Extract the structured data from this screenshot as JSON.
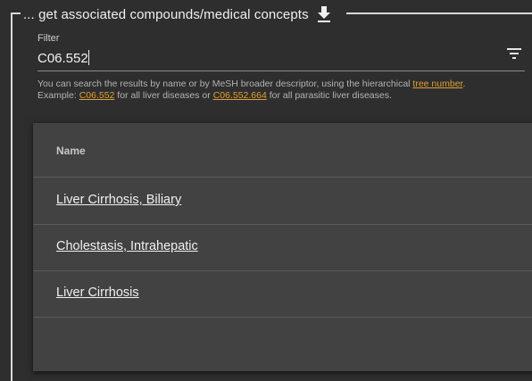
{
  "section": {
    "legend": "... get associated compounds/medical concepts"
  },
  "filter": {
    "label": "Filter",
    "value": "C06.552",
    "hint_prefix": "You can search the results by name or by MeSH broader descriptor, using the hierarchical ",
    "hint_link_tree": "tree number",
    "hint_after_tree": ".",
    "hint_example_prefix": "Example: ",
    "hint_link_example1": "C06.552",
    "hint_mid": " for all liver diseases or ",
    "hint_link_example2": "C06.552.664",
    "hint_suffix": " for all parasitic liver diseases."
  },
  "table": {
    "column_header": "Name",
    "rows": [
      {
        "name": "Liver Cirrhosis, Biliary"
      },
      {
        "name": "Cholestasis, Intrahepatic"
      },
      {
        "name": "Liver Cirrhosis"
      }
    ]
  },
  "colors": {
    "background": "#2e2e2e",
    "card": "#424242",
    "link_accent": "#e0a030"
  },
  "icons": {
    "download": "download-icon",
    "filter": "filter-list-icon"
  }
}
